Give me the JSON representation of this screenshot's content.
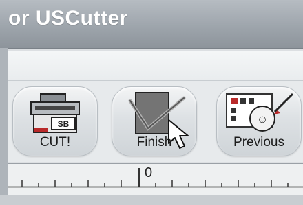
{
  "window": {
    "title": "or USCutter"
  },
  "toolbar": {
    "buttons": [
      {
        "label": "CUT!",
        "icon": "printer-cut-icon"
      },
      {
        "label": "Finish",
        "icon": "checkbox-check-icon"
      },
      {
        "label": "Previous",
        "icon": "previous-preview-icon"
      }
    ]
  },
  "ruler": {
    "zero_label": "0"
  },
  "colors": {
    "titlebar": "#9ea5ac",
    "accent_red": "#b92a2a",
    "check_green": "#6e6e6e"
  }
}
